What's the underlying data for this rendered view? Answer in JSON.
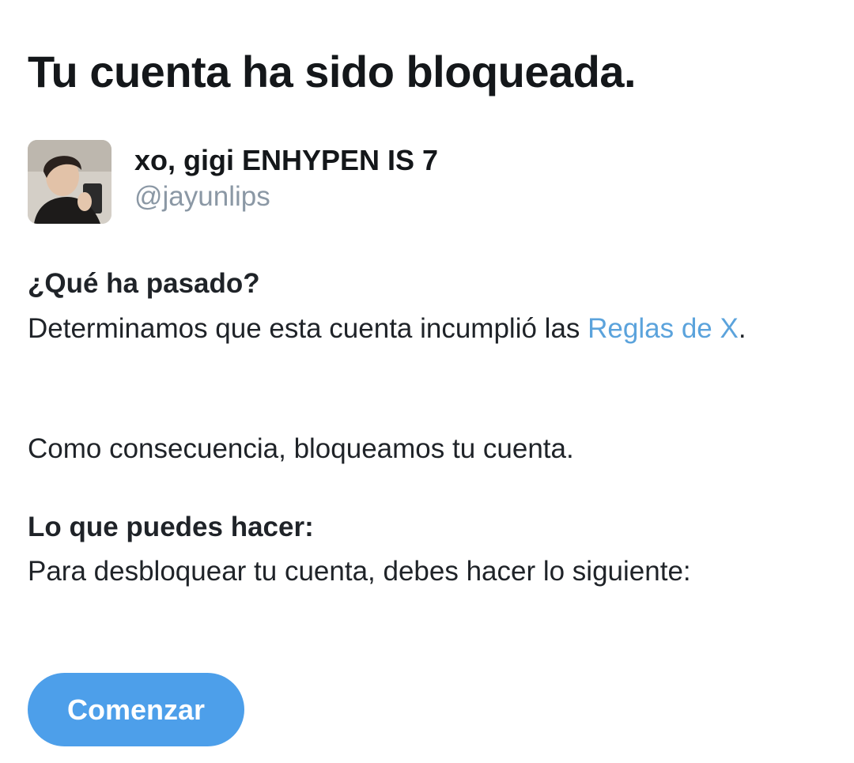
{
  "title": "Tu cuenta ha sido bloqueada.",
  "account": {
    "display_name": "xo, gigi ENHYPEN IS 7",
    "handle": "@jayunlips"
  },
  "what_happened": {
    "heading": "¿Qué ha pasado?",
    "text_before_link": "Determinamos que esta cuenta incumplió las ",
    "link_text": "Reglas de X",
    "text_after_link": ".",
    "consequence": "Como consecuencia, bloqueamos tu cuenta."
  },
  "what_you_can_do": {
    "heading": "Lo que puedes hacer:",
    "text": "Para desbloquear tu cuenta, debes hacer lo siguiente:"
  },
  "start_button": "Comenzar",
  "colors": {
    "link": "#5ba3dc",
    "button": "#4d9fea",
    "handle": "#8b98a5"
  }
}
